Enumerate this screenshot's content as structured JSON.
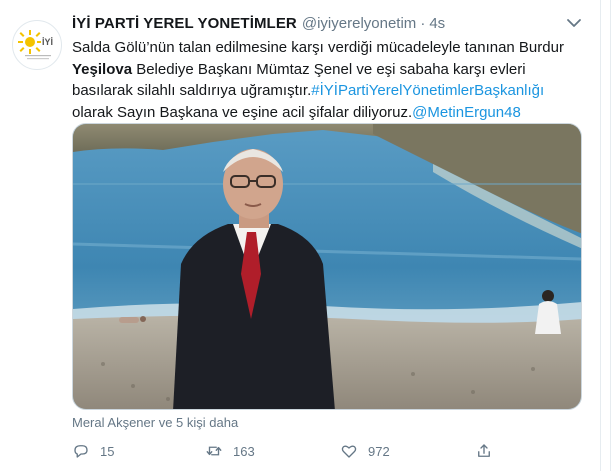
{
  "author": {
    "name": "İYİ PARTİ YEREL YONETİMLER",
    "handle": "@iyiyerelyonetim",
    "separator": "·",
    "time": "4s",
    "avatar_logo_text": "İYİ"
  },
  "tweet": {
    "line1": "Salda Gölü’nün talan edilmesine karşı verdiği mücadeleyle tanınan Burdur",
    "line2_bold": "Yeşilova",
    "line2_rest": " Belediye Başkanı Mümtaz Şenel  ve eşi sabaha karşı evleri",
    "line3_text": "basılarak silahlı saldırıya uğramıştır.",
    "line3_hashtag": "#İYİPartiYerelYönetimlerBaşkanlığı",
    "line4_text": "olarak Sayın Başkana ve eşine acil şifalar diliyoruz.",
    "line4_mention": "@MetinErgun48"
  },
  "likers_text": "Meral Akşener ve 5 kişi daha",
  "actions": {
    "reply_count": "15",
    "retweet_count": "163",
    "like_count": "972"
  },
  "icons": {
    "caret": "chevron-down-icon",
    "reply": "reply-icon",
    "retweet": "retweet-icon",
    "like": "heart-icon",
    "share": "share-icon"
  },
  "colors": {
    "link": "#1b95e0",
    "secondary_text": "#657786",
    "logo_yellow": "#f4c300",
    "sea": "#3e86b2"
  }
}
